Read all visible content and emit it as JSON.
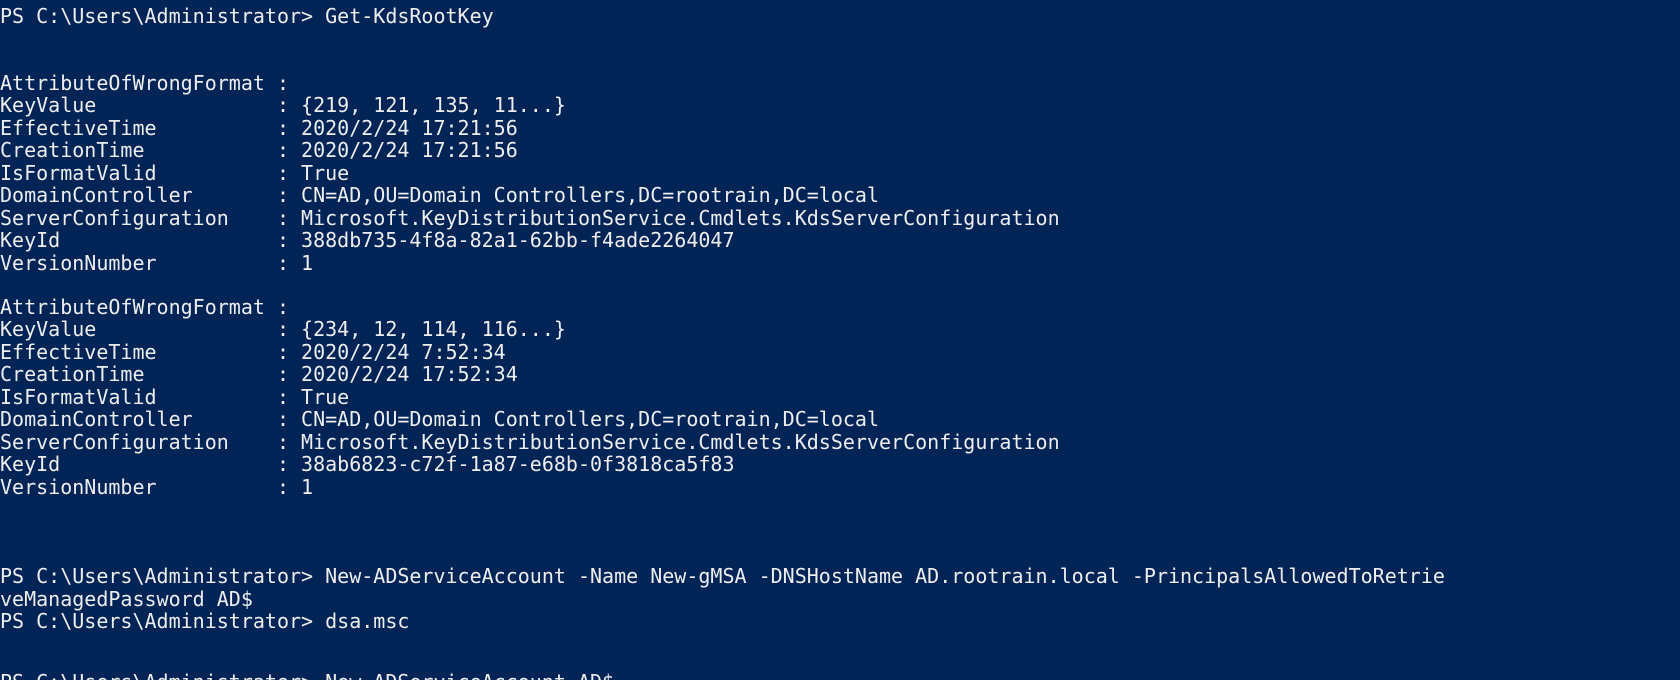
{
  "console": {
    "lines": [
      "PS C:\\Users\\Administrator> Get-KdsRootKey",
      "",
      "",
      "AttributeOfWrongFormat :",
      "KeyValue               : {219, 121, 135, 11...}",
      "EffectiveTime          : 2020/2/24 17:21:56",
      "CreationTime           : 2020/2/24 17:21:56",
      "IsFormatValid          : True",
      "DomainController       : CN=AD,OU=Domain Controllers,DC=rootrain,DC=local",
      "ServerConfiguration    : Microsoft.KeyDistributionService.Cmdlets.KdsServerConfiguration",
      "KeyId                  : 388db735-4f8a-82a1-62bb-f4ade2264047",
      "VersionNumber          : 1",
      "",
      "AttributeOfWrongFormat :",
      "KeyValue               : {234, 12, 114, 116...}",
      "EffectiveTime          : 2020/2/24 7:52:34",
      "CreationTime           : 2020/2/24 17:52:34",
      "IsFormatValid          : True",
      "DomainController       : CN=AD,OU=Domain Controllers,DC=rootrain,DC=local",
      "ServerConfiguration    : Microsoft.KeyDistributionService.Cmdlets.KdsServerConfiguration",
      "KeyId                  : 38ab6823-c72f-1a87-e68b-0f3818ca5f83",
      "VersionNumber          : 1",
      "",
      "",
      "",
      "PS C:\\Users\\Administrator> New-ADServiceAccount -Name New-gMSA -DNSHostName AD.rootrain.local -PrincipalsAllowedToRetrie",
      "veManagedPassword AD$",
      "PS C:\\Users\\Administrator> dsa.msc",
      "PS C:\\Users\\Administrator> New-ADServiceAccount AD$"
    ]
  },
  "colors": {
    "background": "#012456",
    "foreground": "#eeedf0"
  }
}
